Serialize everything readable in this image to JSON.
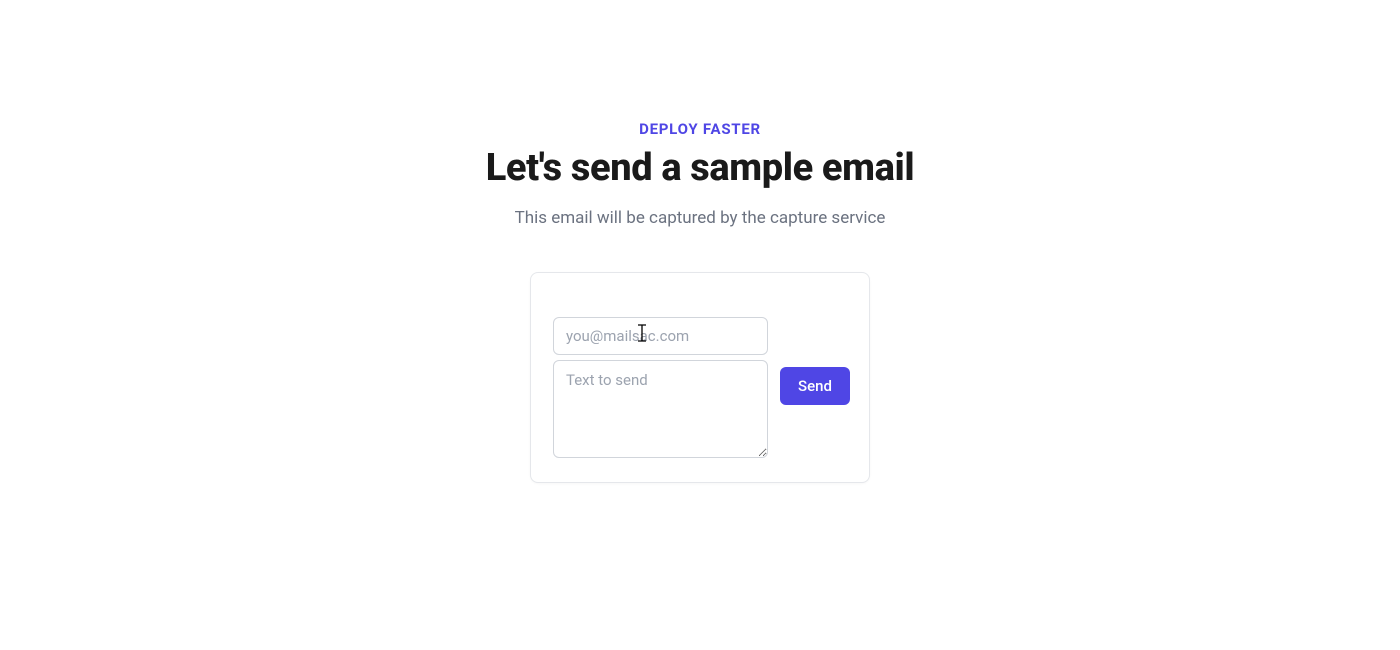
{
  "header": {
    "eyebrow": "DEPLOY FASTER",
    "title": "Let's send a sample email",
    "subtitle": "This email will be captured by the capture service"
  },
  "form": {
    "email": {
      "placeholder": "you@mailsac.com",
      "value": ""
    },
    "body": {
      "placeholder": "Text to send",
      "value": ""
    },
    "send_label": "Send"
  },
  "colors": {
    "accent": "#4f46e5"
  }
}
